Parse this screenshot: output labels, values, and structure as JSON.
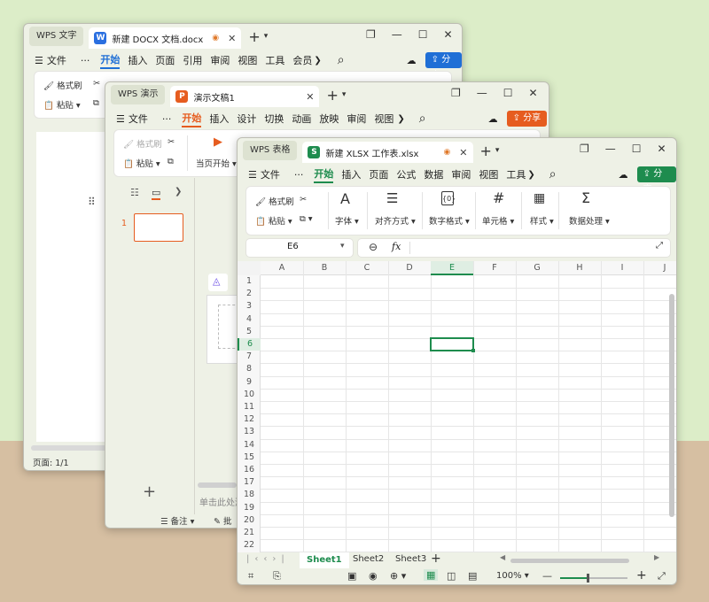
{
  "writer": {
    "app_name": "WPS 文字",
    "tab_title": "新建 DOCX 文档.docx",
    "doc_icon_letter": "W",
    "menu": [
      "开始",
      "插入",
      "页面",
      "引用",
      "审阅",
      "视图",
      "工具",
      "会员"
    ],
    "file_label": "文件",
    "more_label": "···",
    "share_label": "分享",
    "ribbon": {
      "format_painter": "格式刷",
      "paste": "粘贴"
    },
    "status": "页面: 1/1",
    "accent": "#1f6fd6"
  },
  "present": {
    "app_name": "WPS 演示",
    "tab_title": "演示文稿1",
    "doc_icon_letter": "P",
    "menu": [
      "开始",
      "插入",
      "设计",
      "切换",
      "动画",
      "放映",
      "审阅",
      "视图"
    ],
    "file_label": "文件",
    "more_label": "···",
    "share_label": "分享",
    "ribbon": {
      "format_painter": "格式刷",
      "paste": "粘贴",
      "play_from_current": "当页开始"
    },
    "slide_number": "1",
    "notes_placeholder": "单击此处添",
    "status": {
      "notes": "备注",
      "comment": "批"
    },
    "accent": "#e65c1f"
  },
  "sheet": {
    "app_name": "WPS 表格",
    "tab_title": "新建 XLSX 工作表.xlsx",
    "doc_icon_letter": "S",
    "menu": [
      "开始",
      "插入",
      "页面",
      "公式",
      "数据",
      "审阅",
      "视图",
      "工具"
    ],
    "file_label": "文件",
    "more_label": "···",
    "share_label": "分享",
    "ribbon": {
      "format_painter": "格式刷",
      "paste": "粘贴",
      "font": "字体",
      "align": "对齐方式",
      "number_format": "数字格式",
      "cell": "单元格",
      "style": "样式",
      "data_process": "数据处理",
      "font_glyph": "A",
      "align_glyph": "☰",
      "cell_glyph": "#",
      "sum_glyph": "Σ"
    },
    "name_box": "E6",
    "fx_label": "fx",
    "columns": [
      "A",
      "B",
      "C",
      "D",
      "E",
      "F",
      "G",
      "H",
      "I",
      "J"
    ],
    "rows": [
      "1",
      "2",
      "3",
      "4",
      "5",
      "6",
      "7",
      "8",
      "9",
      "10",
      "11",
      "12",
      "13",
      "14",
      "15",
      "16",
      "17",
      "18",
      "19",
      "20",
      "21",
      "22"
    ],
    "active_column": "E",
    "active_row": "6",
    "sheets": [
      "Sheet1",
      "Sheet2",
      "Sheet3"
    ],
    "active_sheet": "Sheet1",
    "zoom": "100%",
    "accent": "#1e8c4e"
  }
}
